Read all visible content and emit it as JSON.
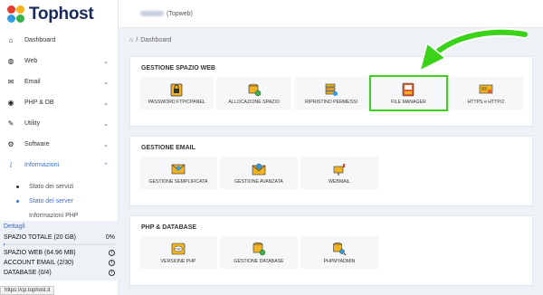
{
  "brand": {
    "name": "Tophost"
  },
  "topbar": {
    "domain_suffix": "(Topweb)"
  },
  "breadcrumb": {
    "current": "Dashboard"
  },
  "sidebar": {
    "items": [
      {
        "label": "Dashboard",
        "icon": "home-icon"
      },
      {
        "label": "Web",
        "icon": "globe-icon"
      },
      {
        "label": "Email",
        "icon": "envelope-icon"
      },
      {
        "label": "PHP & DB",
        "icon": "php-icon"
      },
      {
        "label": "Utility",
        "icon": "wrench-icon"
      },
      {
        "label": "Software",
        "icon": "settings-icon"
      },
      {
        "label": "Informazioni",
        "icon": "info-icon"
      }
    ],
    "sub_items": [
      {
        "label": "Stato dei servizi"
      },
      {
        "label": "Stato del server"
      },
      {
        "label": "Informazioni PHP"
      }
    ]
  },
  "details": {
    "header": "Dettagli",
    "spazio_totale": "SPAZIO TOTALE (20 GB)",
    "spazio_totale_pct": "0%",
    "spazio_web": "SPAZIO WEB (64.96 MB)",
    "account_email": "ACCOUNT EMAIL (2/30)",
    "database": "DATABASE (0/4)"
  },
  "status_url": "https://cp.tophost.it",
  "sections": {
    "web": {
      "title": "GESTIONE SPAZIO WEB",
      "tiles": [
        {
          "label": "PASSWORD FTP/CPANEL"
        },
        {
          "label": "ALLOCAZIONE SPAZIO"
        },
        {
          "label": "RIPRISTINO PERMESSI"
        },
        {
          "label": "FILE MANAGER"
        },
        {
          "label": "HTTPS e HTTP/2"
        }
      ]
    },
    "email": {
      "title": "GESTIONE EMAIL",
      "tiles": [
        {
          "label": "GESTIONE SEMPLIFICATA"
        },
        {
          "label": "GESTIONE AVANZATA"
        },
        {
          "label": "WEBMAIL"
        }
      ]
    },
    "php": {
      "title": "PHP & DATABASE",
      "tiles": [
        {
          "label": "VERSIONE PHP"
        },
        {
          "label": "GESTIONE DATABASE"
        },
        {
          "label": "PHPMYADMIN"
        }
      ]
    }
  },
  "colors": {
    "accent": "#3a6fd0",
    "highlight": "#3bd21a",
    "icon": "#f0b323"
  }
}
